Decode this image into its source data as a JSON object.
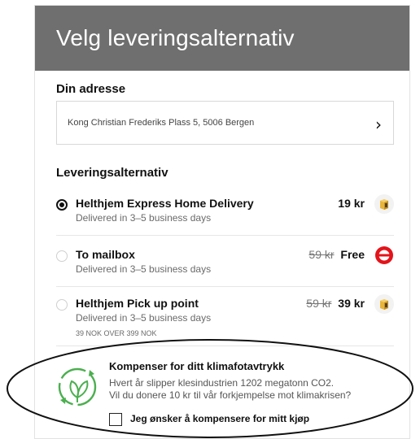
{
  "header": {
    "title": "Velg leveringsalternativ",
    "background": "#6f6f6f"
  },
  "address": {
    "section_title": "Din adresse",
    "value": "Kong Christian Frederiks Plass 5, 5006 Bergen",
    "chevron": "›"
  },
  "delivery": {
    "section_title": "Leveringsalternativ",
    "options": [
      {
        "name": "Helthjem Express Home Delivery",
        "subtitle": "Delivered in 3–5 business days",
        "old_price": "",
        "price": "19 kr",
        "selected": true,
        "icon": "package-box-icon"
      },
      {
        "name": "To mailbox",
        "subtitle": "Delivered in 3–5 business days",
        "old_price": "59 kr",
        "price": "Free",
        "selected": false,
        "icon": "red-mailbox-icon"
      },
      {
        "name": "Helthjem Pick up point",
        "subtitle": "Delivered in 3–5 business days",
        "note": "39 NOK OVER 399 NOK",
        "old_price": "59 kr",
        "price": "39 kr",
        "selected": false,
        "icon": "package-box-icon"
      }
    ]
  },
  "climate": {
    "title": "Kompenser for ditt klimafotavtrykk",
    "text_line1": "Hvert år slipper klesindustrien 1202 megatonn CO2.",
    "text_line2": "Vil du donere 10 kr til vår forkjempelse mot klimakrisen?",
    "checkbox_label": "Jeg ønsker å kompensere for mitt kjøp",
    "checked": false,
    "icon": "recycle-leaf-icon",
    "accent": "#4caf50"
  }
}
